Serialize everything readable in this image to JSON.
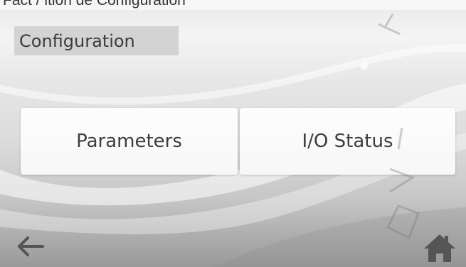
{
  "page": {
    "cut_off_header_text": "Fact          /         ition      de Configuration      "
  },
  "header": {
    "title": "Configuration"
  },
  "menu": {
    "buttons": [
      {
        "label": "Parameters"
      },
      {
        "label": "I/O Status"
      }
    ]
  },
  "footer": {
    "back_icon": "arrow-left",
    "home_icon": "house"
  },
  "colors": {
    "button_bg": "#fafafa",
    "title_bg": "#d3d3d3",
    "text": "#3d3d3d",
    "icon": "#555555"
  }
}
